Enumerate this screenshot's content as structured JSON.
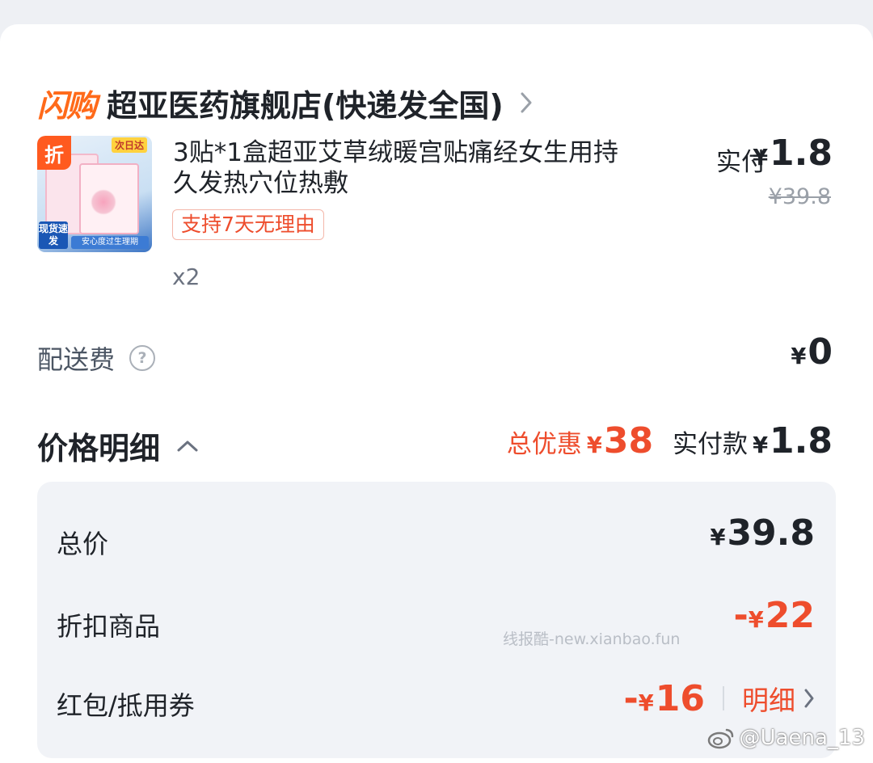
{
  "store": {
    "badge": "闪购",
    "name": "超亚医药旗舰店(快递发全国)"
  },
  "product": {
    "thumb": {
      "discount_badge": "折",
      "corner_tag": "次日达",
      "ship_badge": "现货速发",
      "bottom_banner": "安心度过生理期"
    },
    "title": "3贴*1盒超亚艾草绒暖宫贴痛经女生用持久发热穴位热敷",
    "return_tag": "支持7天无理由",
    "quantity": "x2",
    "pay_label": "实付",
    "pay_amount": "1.8",
    "original_price": "¥39.8"
  },
  "shipping": {
    "label": "配送费",
    "value": "0"
  },
  "price_detail": {
    "title": "价格明细",
    "total_discount_label": "总优惠",
    "total_discount_amount": "38",
    "paid_label": "实付款",
    "paid_amount": "1.8",
    "rows": {
      "total": {
        "label": "总价",
        "value": "39.8"
      },
      "discount_goods": {
        "label": "折扣商品",
        "value": "22"
      },
      "coupon": {
        "label": "红包/抵用券",
        "value": "16",
        "link": "明细"
      }
    }
  },
  "currency_symbol": "¥",
  "minus_symbol": "-",
  "watermark": "线报酷-new.xianbao.fun",
  "weibo_handle": "@Uaena_13",
  "colors": {
    "accent_red": "#ee4d2d",
    "brand_orange": "#ff6a1a",
    "text_primary": "#1f2329",
    "panel_bg": "#f1f3f7"
  }
}
